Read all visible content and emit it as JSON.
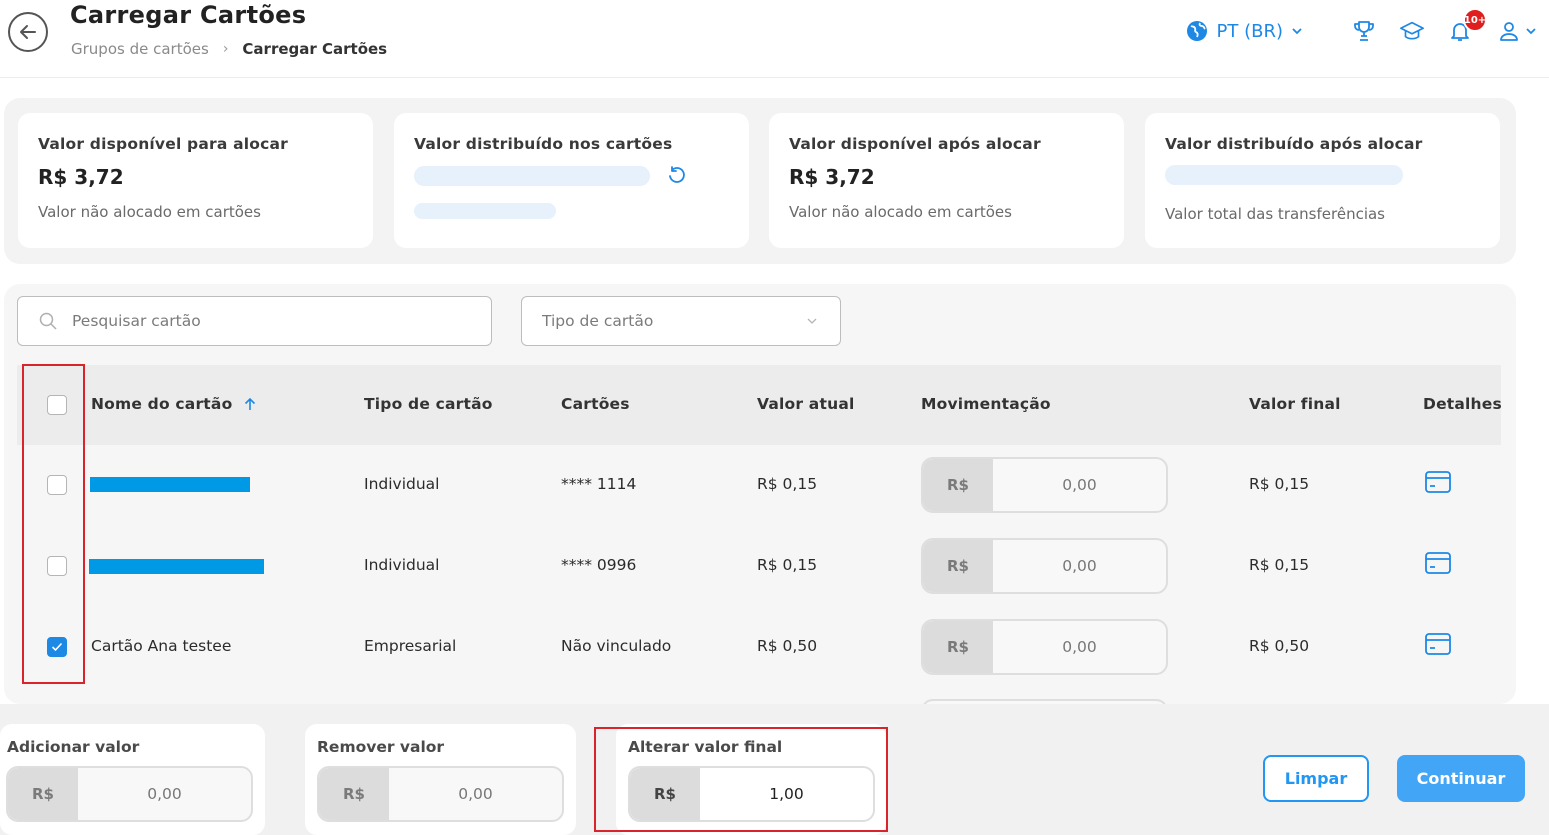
{
  "header": {
    "title": "Carregar Cartões",
    "breadcrumb": [
      "Grupos de cartões",
      "Carregar Cartões"
    ],
    "language": "PT (BR)",
    "notification_badge": "10+"
  },
  "summary": {
    "cards": [
      {
        "label": "Valor disponível para alocar",
        "value": "R$ 3,72",
        "sub": "Valor não alocado em cartões"
      },
      {
        "label": "Valor distribuído nos cartões"
      },
      {
        "label": "Valor disponível após alocar",
        "value": "R$ 3,72",
        "sub": "Valor não alocado em cartões"
      },
      {
        "label": "Valor distribuído após alocar",
        "sub": "Valor total das transferências"
      }
    ]
  },
  "filters": {
    "search_placeholder": "Pesquisar cartão",
    "type_placeholder": "Tipo de cartão"
  },
  "table": {
    "columns": [
      "Nome do cartão",
      "Tipo de cartão",
      "Cartões",
      "Valor atual",
      "Movimentação",
      "Valor final",
      "Detalhes"
    ],
    "currency": "R$",
    "rows": [
      {
        "name": "",
        "type": "Individual",
        "cards": "**** 1114",
        "current": "R$ 0,15",
        "movement": "0,00",
        "final": "R$ 0,15",
        "checked": false
      },
      {
        "name": "",
        "type": "Individual",
        "cards": "**** 0996",
        "current": "R$ 0,15",
        "movement": "0,00",
        "final": "R$ 0,15",
        "checked": false
      },
      {
        "name": "Cartão Ana testee",
        "type": "Empresarial",
        "cards": "Não vinculado",
        "current": "R$ 0,50",
        "movement": "0,00",
        "final": "R$ 0,50",
        "checked": true
      }
    ]
  },
  "bottom": {
    "add_label": "Adicionar valor",
    "add_value": "0,00",
    "remove_label": "Remover valor",
    "remove_value": "0,00",
    "final_label": "Alterar valor final",
    "final_value": "1,00",
    "clear_button": "Limpar",
    "continue_button": "Continuar"
  },
  "colors": {
    "accent": "#1e88e5",
    "primary_button": "#42a5f5",
    "highlight": "#d9242b"
  }
}
